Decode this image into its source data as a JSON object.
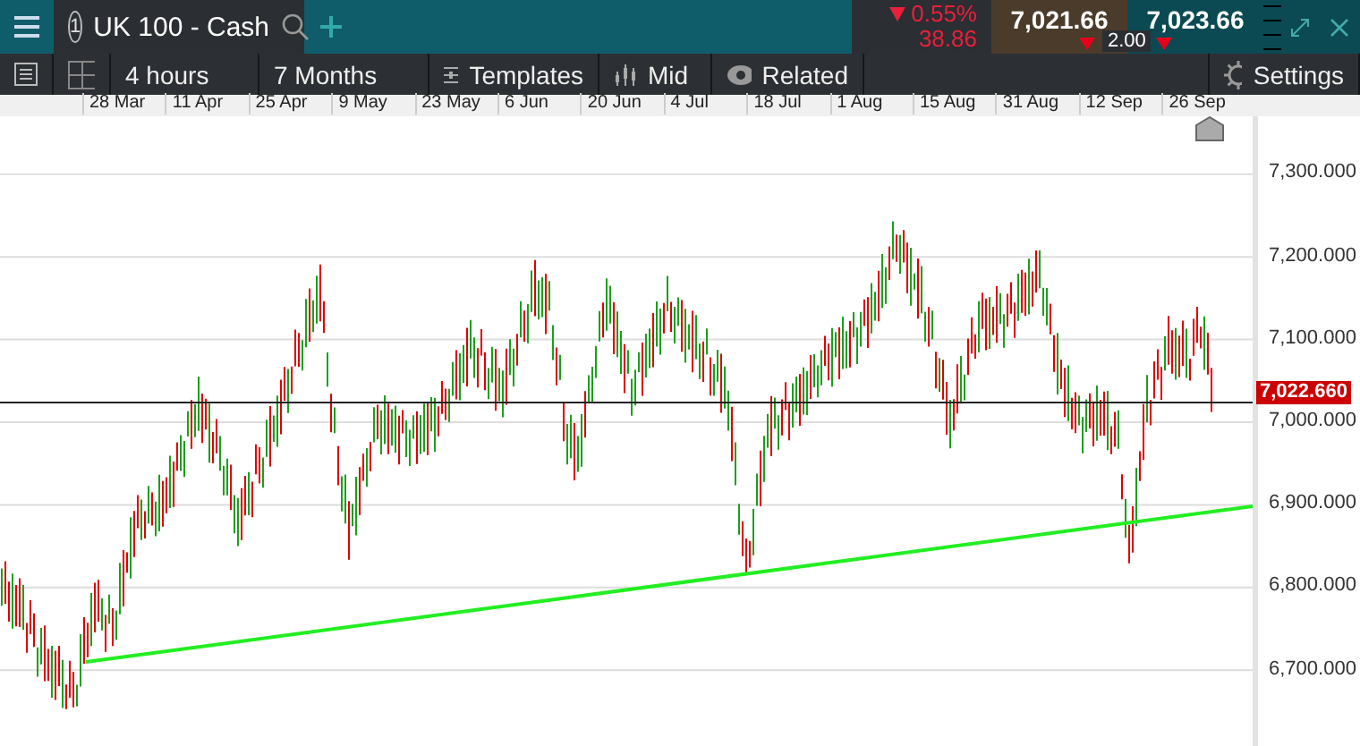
{
  "header": {
    "tab": {
      "number": "1",
      "title": "UK 100 - Cash"
    },
    "change_percent": "0.55%",
    "change_points": "38.86",
    "sell": "7,021.66",
    "buy": "7,023.66",
    "spread": "2.00"
  },
  "toolbar": {
    "interval": "4 hours",
    "range": "7 Months",
    "templates": "Templates",
    "price_type": "Mid",
    "related": "Related",
    "settings": "Settings"
  },
  "date_axis": [
    "28 Mar",
    "11 Apr",
    "25 Apr",
    "9 May",
    "23 May",
    "6 Jun",
    "20 Jun",
    "4 Jul",
    "18 Jul",
    "1 Aug",
    "15 Aug",
    "31 Aug",
    "12 Sep",
    "26 Sep"
  ],
  "price_axis": [
    "7,300.000",
    "7,200.000",
    "7,100.000",
    "7,000.000",
    "6,900.000",
    "6,800.000",
    "6,700.000"
  ],
  "current_price": "7,022.660"
}
